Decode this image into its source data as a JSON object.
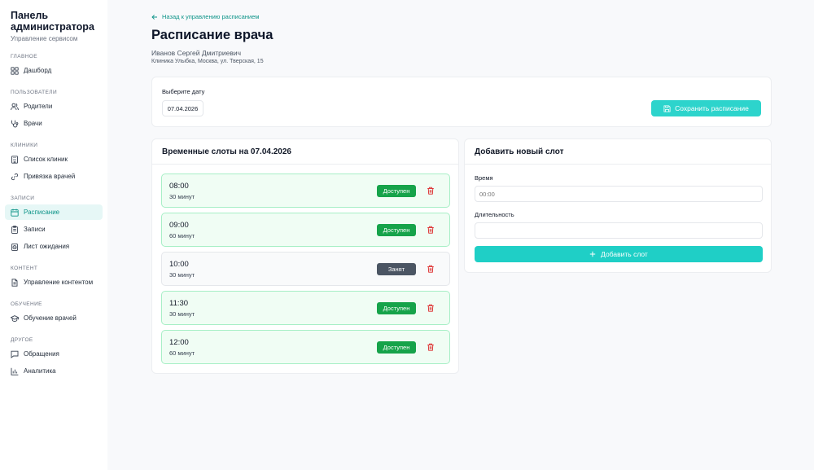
{
  "brand": {
    "title": "Панель администратора",
    "subtitle": "Управление сервисом"
  },
  "sidebar": {
    "sections": [
      {
        "label": "ГЛАВНОЕ",
        "items": [
          {
            "label": "Дашборд",
            "icon": "dashboard-icon"
          }
        ]
      },
      {
        "label": "ПОЛЬЗОВАТЕЛИ",
        "items": [
          {
            "label": "Родители",
            "icon": "users-icon"
          },
          {
            "label": "Врачи",
            "icon": "stethoscope-icon"
          }
        ]
      },
      {
        "label": "КЛИНИКИ",
        "items": [
          {
            "label": "Список клиник",
            "icon": "building-icon"
          },
          {
            "label": "Привязка врачей",
            "icon": "link-icon"
          }
        ]
      },
      {
        "label": "ЗАПИСИ",
        "items": [
          {
            "label": "Расписание",
            "icon": "calendar-icon",
            "active": true
          },
          {
            "label": "Записи",
            "icon": "clipboard-icon"
          },
          {
            "label": "Лист ожидания",
            "icon": "clock-icon"
          }
        ]
      },
      {
        "label": "КОНТЕНТ",
        "items": [
          {
            "label": "Управление контентом",
            "icon": "file-icon"
          }
        ]
      },
      {
        "label": "ОБУЧЕНИЕ",
        "items": [
          {
            "label": "Обучение врачей",
            "icon": "graduation-cap-icon"
          }
        ]
      },
      {
        "label": "ДРУГОЕ",
        "items": [
          {
            "label": "Обращения",
            "icon": "message-icon"
          },
          {
            "label": "Аналитика",
            "icon": "bar-chart-icon"
          }
        ]
      }
    ]
  },
  "header": {
    "back_label": "Назад к управлению расписанием",
    "title": "Расписание врача",
    "doctor_name": "Иванов Сергей Дмитриевич",
    "clinic": "Клиника Улыбка, Москва, ул. Тверская, 15"
  },
  "date_picker": {
    "label": "Выберите дату",
    "value": "07.04.2026",
    "save_label": "Сохранить расписание"
  },
  "slots": {
    "title": "Временные слоты на 07.04.2026",
    "items": [
      {
        "time": "08:00",
        "duration": "30 минут",
        "status": "Доступен",
        "booked": false
      },
      {
        "time": "09:00",
        "duration": "60 минут",
        "status": "Доступен",
        "booked": false
      },
      {
        "time": "10:00",
        "duration": "30 минут",
        "status": "Занят",
        "booked": true
      },
      {
        "time": "11:30",
        "duration": "30 минут",
        "status": "Доступен",
        "booked": false
      },
      {
        "time": "12:00",
        "duration": "60 минут",
        "status": "Доступен",
        "booked": false
      }
    ]
  },
  "add_slot": {
    "title": "Добавить новый слот",
    "time_label": "Время",
    "time_placeholder": "00:00",
    "duration_label": "Длительность",
    "duration_value": "",
    "add_label": "Добавить слот"
  },
  "colors": {
    "accent": "#2dd4cc",
    "available": "#16a34a",
    "booked": "#4b5563",
    "danger": "#dc2626"
  }
}
